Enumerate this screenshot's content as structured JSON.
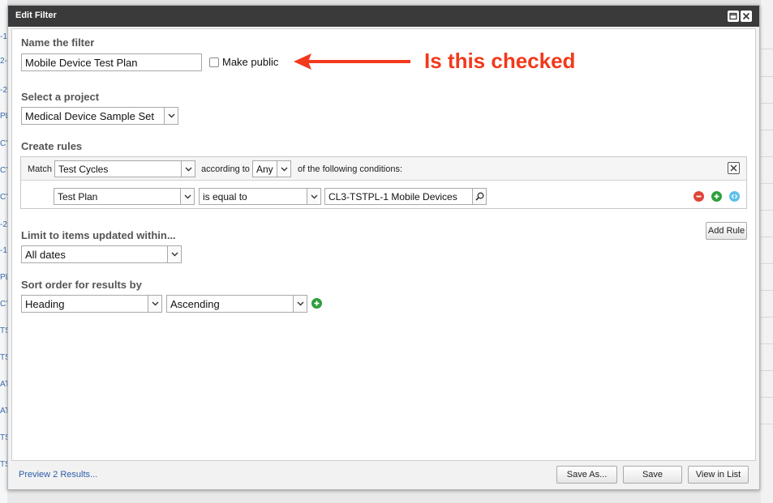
{
  "dialog": {
    "title": "Edit Filter"
  },
  "name_section": {
    "label": "Name the filter",
    "value": "Mobile Device Test Plan",
    "make_public_label": "Make public",
    "make_public_checked": false
  },
  "project_section": {
    "label": "Select a project",
    "selected": "Medical Device Sample Set"
  },
  "rules_section": {
    "label": "Create rules",
    "match_label": "Match",
    "match_value": "Test Cycles",
    "according_to_label": "according to",
    "any_value": "Any",
    "conditions_label": "of the following conditions:",
    "rule": {
      "field": "Test Plan",
      "operator": "is equal to",
      "value": "CL3-TSTPL-1 Mobile Devices"
    },
    "add_rule_label": "Add Rule"
  },
  "limit_section": {
    "label": "Limit to items updated within...",
    "selected": "All dates"
  },
  "sort_section": {
    "label": "Sort order for results by",
    "field": "Heading",
    "direction": "Ascending"
  },
  "footer": {
    "preview_link": "Preview 2 Results...",
    "save_as_label": "Save As...",
    "save_label": "Save",
    "view_in_list_label": "View in List"
  },
  "annotation": {
    "text": "Is this checked",
    "color": "#f2391c"
  },
  "background": {
    "left_fragments": [
      "-1",
      "2-",
      "-2",
      "PL",
      "CY",
      "CY",
      "CY",
      "-2",
      "-1",
      "PL",
      "CY",
      "TS",
      "TS",
      "AT",
      "AT",
      "TS",
      "TS"
    ]
  },
  "colors": {
    "titlebar": "#3a3a3a",
    "remove_icon": "#e0453a",
    "add_icon": "#2e9e3a",
    "move_icon": "#5cc0ea",
    "link": "#2a5ea8"
  }
}
